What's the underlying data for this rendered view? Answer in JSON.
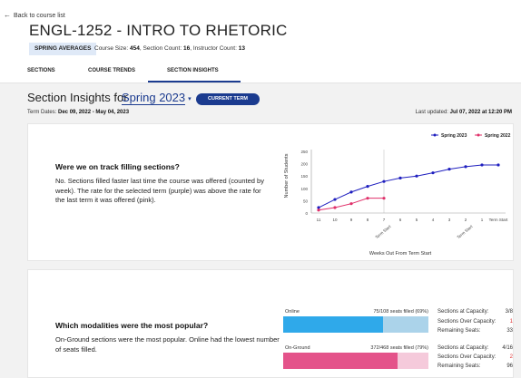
{
  "header": {
    "back_label": "Back to course list",
    "course_title": "ENGL-1252 - INTRO TO RHETORIC",
    "averages_badge": "SPRING AVERAGES",
    "course_size_label": "Course Size:",
    "course_size": "454",
    "section_count_label": "Section Count:",
    "section_count": "16",
    "instructor_count_label": "Instructor Count:",
    "instructor_count": "13"
  },
  "tabs": [
    {
      "label": "SECTIONS"
    },
    {
      "label": "COURSE TRENDS"
    },
    {
      "label": "SECTION INSIGHTS",
      "active": true
    }
  ],
  "insights": {
    "heading": "Section Insights for",
    "term": "Spring 2023",
    "current_term_button": "CURRENT TERM",
    "term_dates_label": "Term Dates:",
    "term_dates": "Dec 09, 2022 - May 04, 2023",
    "last_updated_label": "Last updated:",
    "last_updated": "Jul 07, 2022 at 12:20 PM"
  },
  "card1": {
    "question": "Were we on track filling sections?",
    "text": "No. Sections filled faster last time the course was offered (counted by week). The rate for the selected term (purple) was above the rate for the last term it was offered (pink)."
  },
  "chart_data": {
    "type": "line",
    "x": [
      "11",
      "10",
      "9",
      "8",
      "7",
      "6",
      "5",
      "4",
      "3",
      "2",
      "1",
      "Term Start"
    ],
    "series": [
      {
        "name": "Spring 2023",
        "color": "#1f1fbf",
        "values": [
          22,
          55,
          85,
          108,
          128,
          142,
          150,
          163,
          178,
          188,
          195,
          195
        ]
      },
      {
        "name": "Spring 2022",
        "color": "#e0306a",
        "values": [
          12,
          22,
          38,
          60,
          60,
          null,
          null,
          null,
          null,
          null,
          null,
          null
        ]
      }
    ],
    "ylabel": "Number of Students",
    "xlabel": "Weeks Out From Term Start",
    "yticks": [
      0,
      50,
      100,
      150,
      200,
      250
    ],
    "ylim": [
      0,
      250
    ],
    "annotations": [
      "Term Start",
      "Term Start"
    ],
    "legend": "top-right",
    "grid": false
  },
  "card2": {
    "question": "Which modalities were the most popular?",
    "text": "On-Ground sections were the most popular. Online had the lowest number of seats filled.",
    "modalities": [
      {
        "name": "Online",
        "seats_text": "75/108 seats filled (69%)",
        "fill_fraction": 0.69,
        "fill_color": "#2fa9ea",
        "track_color": "#abd3ea",
        "cap_label": "Sections at Capacity:",
        "cap_value": "3/8",
        "over_label": "Sections Over Capacity:",
        "over_value": "1",
        "rem_label": "Remaining Seats:",
        "rem_value": "33"
      },
      {
        "name": "On-Ground",
        "seats_text": "372/468 seats filled (79%)",
        "fill_fraction": 0.79,
        "fill_color": "#e4538a",
        "track_color": "#f5cadb",
        "cap_label": "Sections at Capacity:",
        "cap_value": "4/16",
        "over_label": "Sections Over Capacity:",
        "over_value": "2",
        "rem_label": "Remaining Seats:",
        "rem_value": "96"
      }
    ]
  }
}
